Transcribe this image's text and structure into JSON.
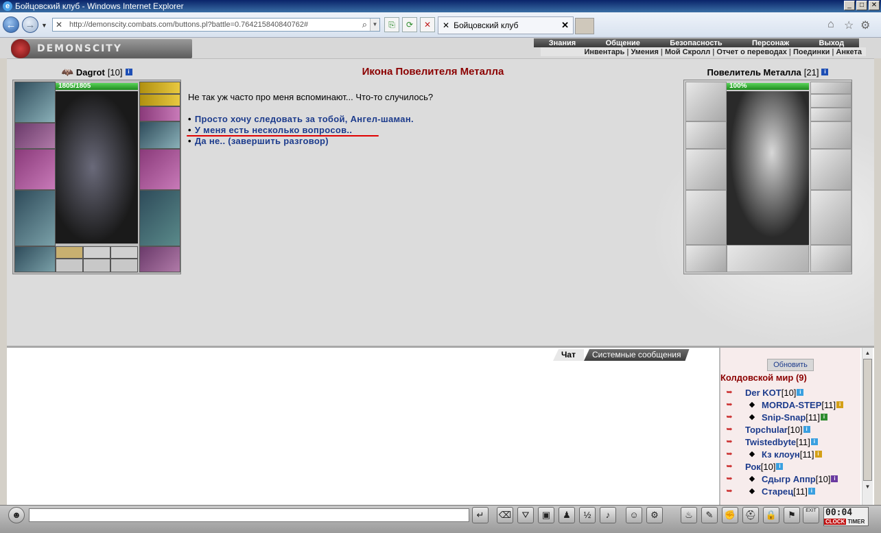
{
  "window": {
    "title": "Бойцовский клуб - Windows Internet Explorer"
  },
  "browser": {
    "url": "http://demonscity.combats.com/buttons.pl?battle=0.764215840840762#",
    "tab_title": "Бойцовский клуб"
  },
  "game": {
    "logo": "DEMONSCITY",
    "top_menu": [
      "Знания",
      "Общение",
      "Безопасность",
      "Персонаж",
      "Выход"
    ],
    "sub_menu": [
      "Инвентарь",
      "Умения",
      "Мой Скролл",
      "Отчет о переводах",
      "Поединки",
      "Анкета"
    ],
    "player": {
      "name": "Dagrot",
      "level": "[10]",
      "hp": "1805/1805",
      "hp_fill": 1.0
    },
    "npc": {
      "title": "Икона Повелителя Металла",
      "name": "Повелитель Металла",
      "level": "[21]",
      "hp": "100%",
      "hp_fill": 1.0
    },
    "dialog": {
      "text": "Не так уж часто про меня вспоминают... Что-то случилось?",
      "options": [
        "Просто хочу следовать за тобой, Ангел-шаман.",
        "У меня есть несколько вопросов..",
        "Да не.. (завершить разговор)"
      ],
      "bullet": "•"
    }
  },
  "chat": {
    "tabs": [
      "Чат",
      "Системные сообщения"
    ],
    "refresh_label": "Обновить",
    "room": "Колдовской мир (9)",
    "users": [
      {
        "name": "Der KOT",
        "level": "[10]",
        "info_color": "#3aa0e0",
        "clan": false
      },
      {
        "name": "MORDA-STEP",
        "level": "[11]",
        "info_color": "#d4a017",
        "clan": true
      },
      {
        "name": "Snip-Snap",
        "level": "[11]",
        "info_color": "#2e8b2e",
        "clan": true
      },
      {
        "name": "Topchular",
        "level": "[10]",
        "info_color": "#3aa0e0",
        "clan": false
      },
      {
        "name": "Twistedbyte",
        "level": "[11]",
        "info_color": "#3aa0e0",
        "clan": false
      },
      {
        "name": "Кз клоун",
        "level": "[11]",
        "info_color": "#d4a017",
        "clan": true
      },
      {
        "name": "Рок",
        "level": "[10]",
        "info_color": "#3aa0e0",
        "clan": false
      },
      {
        "name": "Сдыгр Аппр",
        "level": "[10]",
        "info_color": "#6a3aa0",
        "clan": true
      },
      {
        "name": "Старец",
        "level": "[11]",
        "info_color": "#3aa0e0",
        "clan": true
      }
    ]
  },
  "clock": {
    "time": "00:04",
    "label_clock": "CLOCK",
    "label_timer": "TIMER",
    "exit_label": "EXIT"
  }
}
